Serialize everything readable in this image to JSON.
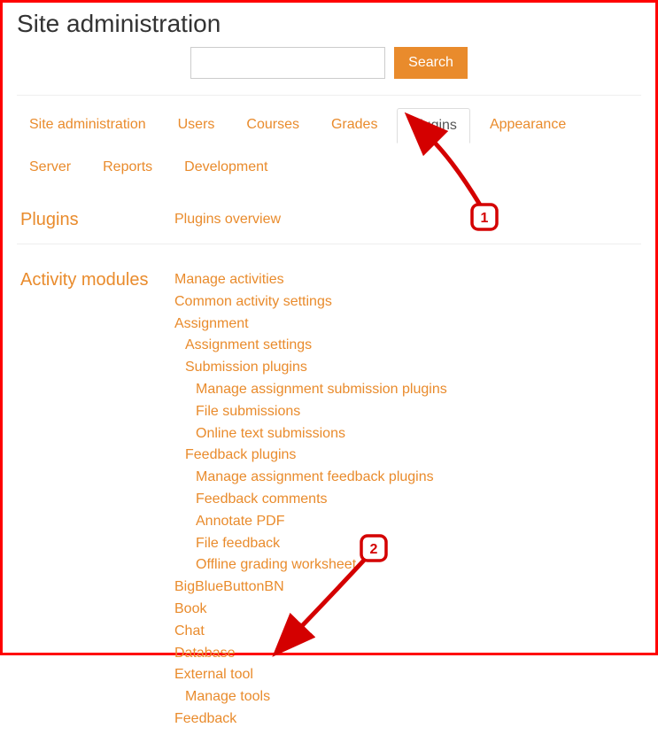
{
  "page": {
    "title": "Site administration",
    "search_button": "Search",
    "search_placeholder": ""
  },
  "tabs": [
    "Site administration",
    "Users",
    "Courses",
    "Grades",
    "Plugins",
    "Appearance",
    "Server",
    "Reports",
    "Development"
  ],
  "active_tab_index": 4,
  "sections": {
    "plugins": {
      "label": "Plugins",
      "overview": "Plugins overview"
    },
    "activity": {
      "label": "Activity modules",
      "items": {
        "manage_activities": "Manage activities",
        "common_activity_settings": "Common activity settings",
        "assignment": "Assignment",
        "assignment_settings": "Assignment settings",
        "submission_plugins": "Submission plugins",
        "manage_submission_plugins": "Manage assignment submission plugins",
        "file_submissions": "File submissions",
        "online_text_submissions": "Online text submissions",
        "feedback_plugins": "Feedback plugins",
        "manage_feedback_plugins": "Manage assignment feedback plugins",
        "feedback_comments": "Feedback comments",
        "annotate_pdf": "Annotate PDF",
        "file_feedback": "File feedback",
        "offline_grading_worksheet": "Offline grading worksheet",
        "bigbluebuttonbn": "BigBlueButtonBN",
        "book": "Book",
        "chat": "Chat",
        "database": "Database",
        "external_tool": "External tool",
        "manage_tools": "Manage tools",
        "feedback": "Feedback"
      }
    }
  },
  "annotations": {
    "callout1": "1",
    "callout2": "2"
  }
}
